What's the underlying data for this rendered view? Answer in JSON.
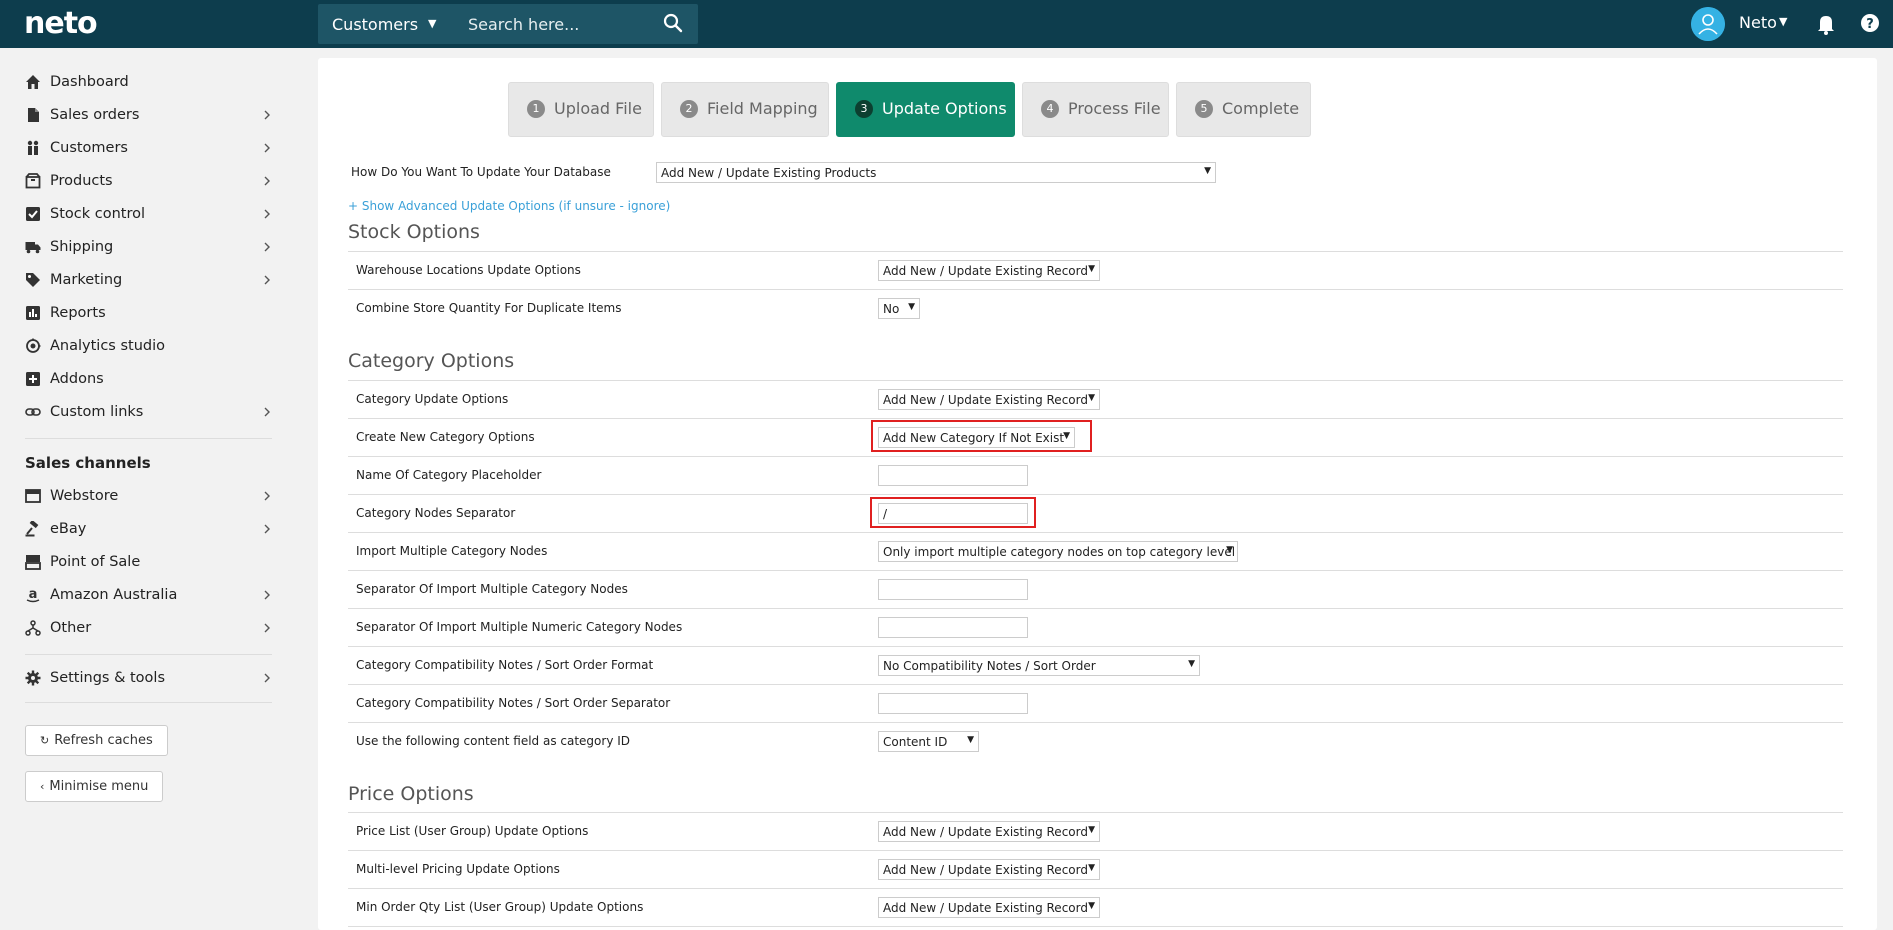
{
  "topbar": {
    "logo": "neto",
    "search_scope": "Customers",
    "search_placeholder": "Search here...",
    "user_name": "Neto"
  },
  "sidebar": {
    "items": [
      {
        "label": "Dashboard",
        "icon": "home-icon"
      },
      {
        "label": "Sales orders",
        "icon": "document-icon"
      },
      {
        "label": "Customers",
        "icon": "people-icon"
      },
      {
        "label": "Products",
        "icon": "box-icon"
      },
      {
        "label": "Stock control",
        "icon": "checkbox-icon"
      },
      {
        "label": "Shipping",
        "icon": "truck-icon"
      },
      {
        "label": "Marketing",
        "icon": "tag-icon"
      },
      {
        "label": "Reports",
        "icon": "bar-chart-icon"
      },
      {
        "label": "Analytics studio",
        "icon": "analytics-icon"
      },
      {
        "label": "Addons",
        "icon": "plus-square-icon"
      },
      {
        "label": "Custom links",
        "icon": "link-icon"
      }
    ],
    "channels_title": "Sales channels",
    "channels": [
      {
        "label": "Webstore",
        "icon": "store-icon"
      },
      {
        "label": "eBay",
        "icon": "gavel-icon"
      },
      {
        "label": "Point of Sale",
        "icon": "register-icon"
      },
      {
        "label": "Amazon Australia",
        "icon": "amazon-icon"
      },
      {
        "label": "Other",
        "icon": "network-icon"
      }
    ],
    "settings_label": "Settings & tools",
    "refresh_label": "Refresh caches",
    "minimise_label": "Minimise menu"
  },
  "steps": [
    {
      "num": "1",
      "label": "Upload File"
    },
    {
      "num": "2",
      "label": "Field Mapping"
    },
    {
      "num": "3",
      "label": "Update Options"
    },
    {
      "num": "4",
      "label": "Process File"
    },
    {
      "num": "5",
      "label": "Complete"
    }
  ],
  "db_update": {
    "label": "How Do You Want To Update Your Database",
    "value": "Add New / Update Existing Products"
  },
  "advanced_link": "+ Show Advanced Update Options (if unsure - ignore)",
  "stock": {
    "title": "Stock Options",
    "rows": [
      {
        "label": "Warehouse Locations Update Options",
        "value": "Add New / Update Existing Record"
      },
      {
        "label": "Combine Store Quantity For Duplicate Items",
        "value": "No"
      }
    ]
  },
  "category": {
    "title": "Category Options",
    "rows": [
      {
        "label": "Category Update Options",
        "value": "Add New / Update Existing Record"
      },
      {
        "label": "Create New Category Options",
        "value": "Add New Category If Not Exist"
      },
      {
        "label": "Name Of Category Placeholder",
        "value": ""
      },
      {
        "label": "Category Nodes Separator",
        "value": "/"
      },
      {
        "label": "Import Multiple Category Nodes",
        "value": "Only import multiple category nodes on top category level"
      },
      {
        "label": "Separator Of Import Multiple Category Nodes",
        "value": ""
      },
      {
        "label": "Separator Of Import Multiple Numeric Category Nodes",
        "value": ""
      },
      {
        "label": "Category Compatibility Notes / Sort Order Format",
        "value": "No Compatibility Notes / Sort Order"
      },
      {
        "label": "Category Compatibility Notes / Sort Order Separator",
        "value": ""
      },
      {
        "label": "Use the following content field as category ID",
        "value": "Content ID"
      }
    ]
  },
  "price": {
    "title": "Price Options",
    "rows": [
      {
        "label": "Price List (User Group) Update Options",
        "value": "Add New / Update Existing Record"
      },
      {
        "label": "Multi-level Pricing Update Options",
        "value": "Add New / Update Existing Record"
      },
      {
        "label": "Min Order Qty List (User Group) Update Options",
        "value": "Add New / Update Existing Record"
      }
    ]
  }
}
